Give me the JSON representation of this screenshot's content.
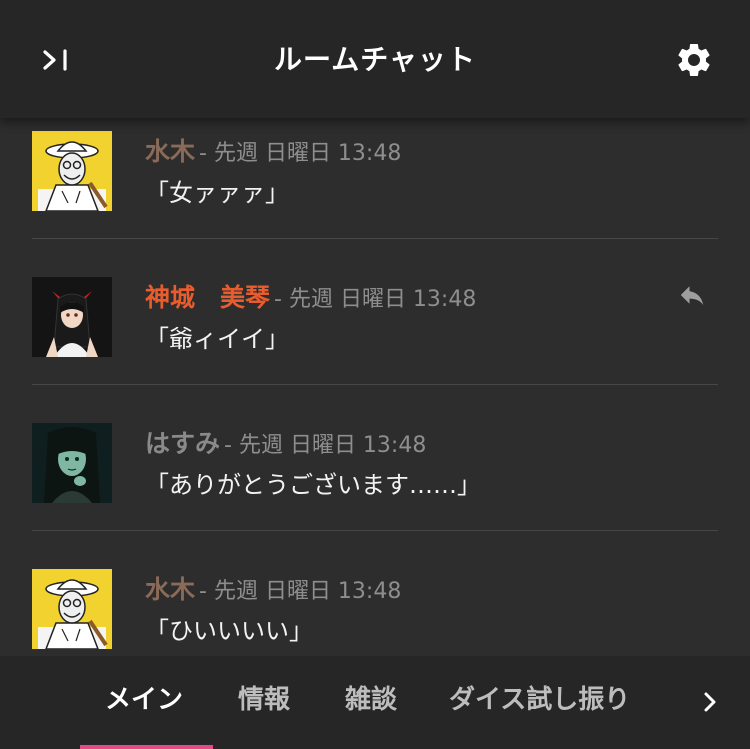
{
  "header": {
    "title": "ルームチャット",
    "collapse_icon": "collapse-sidebar-icon",
    "settings_icon": "gear-icon"
  },
  "messages": [
    {
      "name": "水木",
      "name_color": "#8c6a58",
      "time": "- 先週 日曜日 13:48",
      "text": "「女ァァァ」",
      "has_reply": false
    },
    {
      "name": "神城　美琴",
      "name_color": "#e85c2e",
      "time": "- 先週 日曜日 13:48",
      "text": "「爺ィイイ」",
      "has_reply": true
    },
    {
      "name": "はすみ",
      "name_color": "#8a8a8a",
      "time": "- 先週 日曜日 13:48",
      "text": "「ありがとうございます……」",
      "has_reply": false
    },
    {
      "name": "水木",
      "name_color": "#8c6a58",
      "time": "- 先週 日曜日 13:48",
      "text": "「ひいいいい」",
      "has_reply": false
    }
  ],
  "tabs": [
    {
      "label": "メイン",
      "active": true
    },
    {
      "label": "情報",
      "active": false
    },
    {
      "label": "雑談",
      "active": false
    },
    {
      "label": "ダイス試し振り",
      "active": false
    }
  ],
  "colors": {
    "accent": "#e64a85",
    "background": "#2d2d2d",
    "header": "#262626"
  }
}
